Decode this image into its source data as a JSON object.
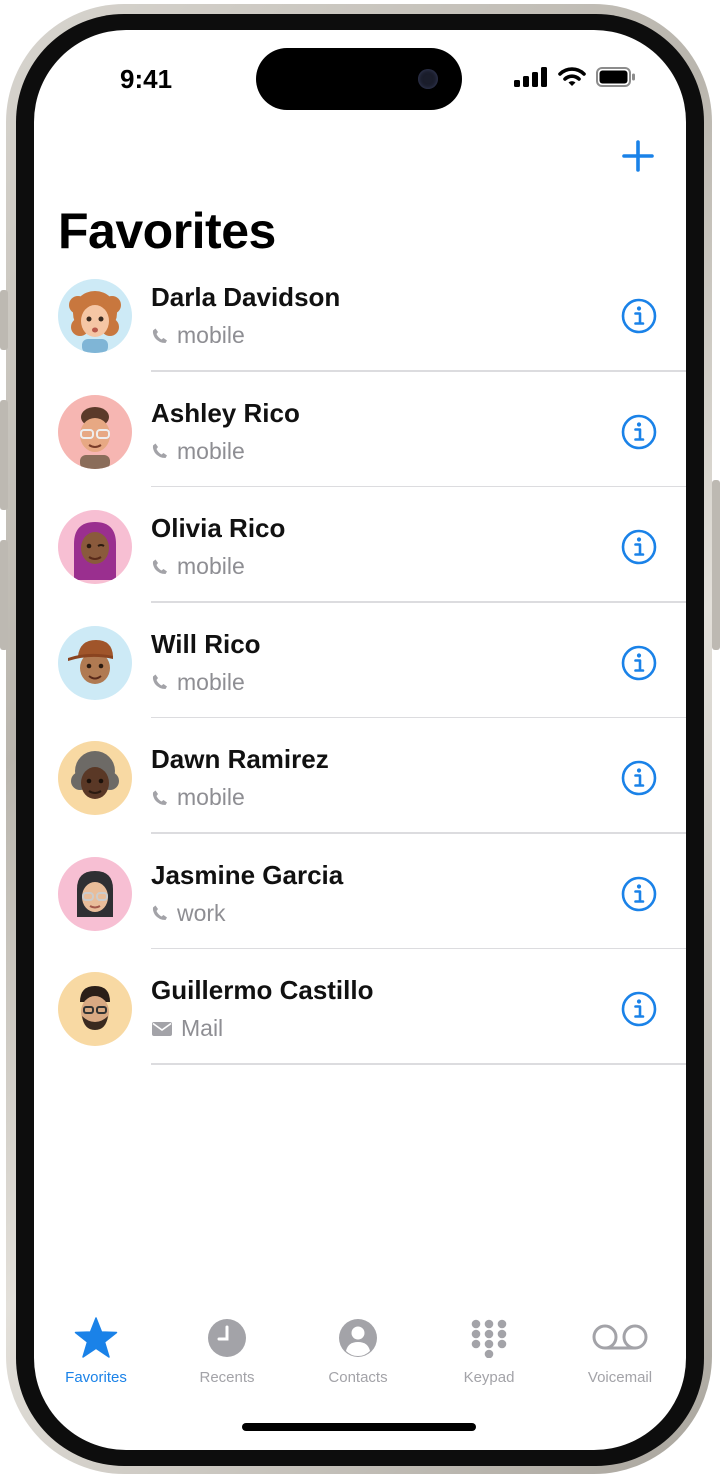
{
  "status_bar": {
    "time": "9:41"
  },
  "header": {
    "title": "Favorites"
  },
  "colors": {
    "accent": "#1a82e8",
    "secondary_text": "#8e8e93",
    "separator": "#dcdcdf"
  },
  "favorites": [
    {
      "name": "Darla Davidson",
      "label": "mobile",
      "label_icon": "phone-icon",
      "avatar_bg": "#cdeaf6"
    },
    {
      "name": "Ashley Rico",
      "label": "mobile",
      "label_icon": "phone-icon",
      "avatar_bg": "#f6b6b2"
    },
    {
      "name": "Olivia Rico",
      "label": "mobile",
      "label_icon": "phone-icon",
      "avatar_bg": "#f7bfd3"
    },
    {
      "name": "Will Rico",
      "label": "mobile",
      "label_icon": "phone-icon",
      "avatar_bg": "#cdeaf6"
    },
    {
      "name": "Dawn Ramirez",
      "label": "mobile",
      "label_icon": "phone-icon",
      "avatar_bg": "#f8d9a3"
    },
    {
      "name": "Jasmine Garcia",
      "label": "work",
      "label_icon": "phone-icon",
      "avatar_bg": "#f7bfd3"
    },
    {
      "name": "Guillermo Castillo",
      "label": "Mail",
      "label_icon": "mail-icon",
      "avatar_bg": "#f8d9a3"
    }
  ],
  "tabs": [
    {
      "label": "Favorites",
      "icon": "star-icon",
      "active": true
    },
    {
      "label": "Recents",
      "icon": "clock-icon",
      "active": false
    },
    {
      "label": "Contacts",
      "icon": "person-circle-icon",
      "active": false
    },
    {
      "label": "Keypad",
      "icon": "keypad-icon",
      "active": false
    },
    {
      "label": "Voicemail",
      "icon": "voicemail-icon",
      "active": false
    }
  ]
}
